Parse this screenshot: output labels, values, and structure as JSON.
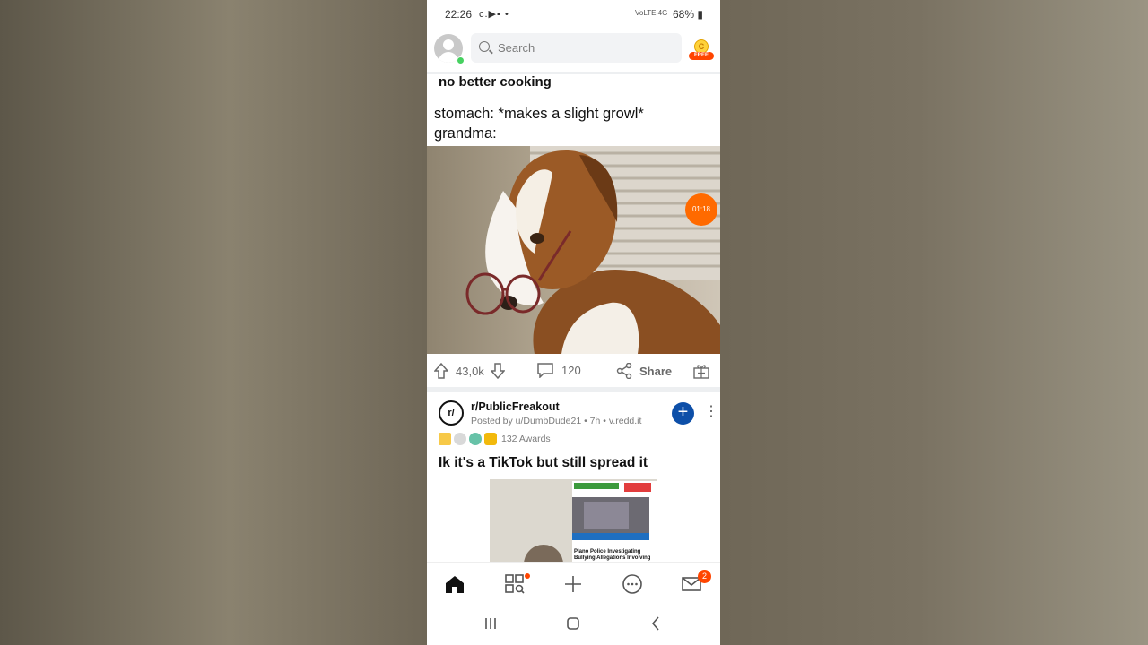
{
  "status_bar": {
    "time": "22:26",
    "icons": "c.▶▪ •",
    "network": "VoLTE 4G",
    "battery": "68%"
  },
  "header": {
    "search_placeholder": "Search",
    "coin_label": "FREE"
  },
  "post1": {
    "title": "no better cooking",
    "meme_lines": [
      "stomach:  *makes a slight growl*",
      "grandma:"
    ],
    "video_timer": "01:18",
    "upvotes": "43,0k",
    "comments": "120",
    "share_label": "Share"
  },
  "post2": {
    "subreddit": "r/PublicFreakout",
    "posted_by": "Posted by u/DumbDude21 • 7h • v.redd.it",
    "awards": "132 Awards",
    "title": "Ik it's a TikTok but still spread it",
    "thumb_caption": "Plano Police Investigating Bullying Allegations Involving"
  },
  "bottom_nav": {
    "inbox_badge": "2"
  },
  "colors": {
    "accent": "#ff4500",
    "join_blue": "#0d4fa8",
    "separator": "#edeff1"
  }
}
